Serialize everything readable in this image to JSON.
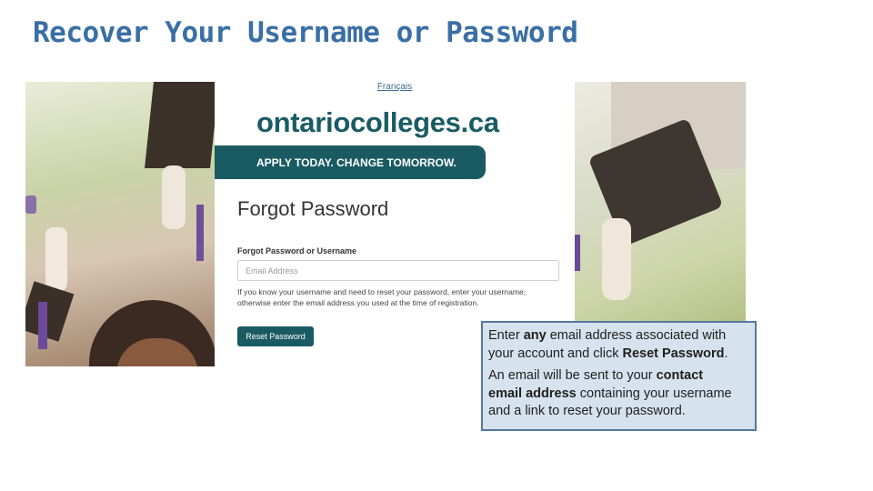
{
  "slide": {
    "title": "Recover Your Username or Password"
  },
  "screenshot": {
    "language_link": "Français",
    "logo_text": "ontariocolleges.ca",
    "banner_text": "APPLY TODAY. CHANGE TOMORROW.",
    "heading": "Forgot Password",
    "field_label": "Forgot Password or Username",
    "email_placeholder": "Email Address",
    "email_value": "",
    "help_text": "If you know your username and need to reset your password, enter your username; otherwise enter the email address you used at the time of registration.",
    "reset_button_label": "Reset Password",
    "colors": {
      "brand": "#1a5b63",
      "link": "#3b6a8d"
    }
  },
  "callout": {
    "p1": {
      "t1": "Enter ",
      "b1": "any",
      "t2": " email address associated with  your account and click ",
      "b2": "Reset Password",
      "t3": "."
    },
    "p2": {
      "t1": "An email will be sent to your ",
      "b1": "contact email address",
      "t2": " containing your username  and a link to reset your password."
    },
    "colors": {
      "fill": "#d6e2ed",
      "border": "#5578a1"
    }
  }
}
